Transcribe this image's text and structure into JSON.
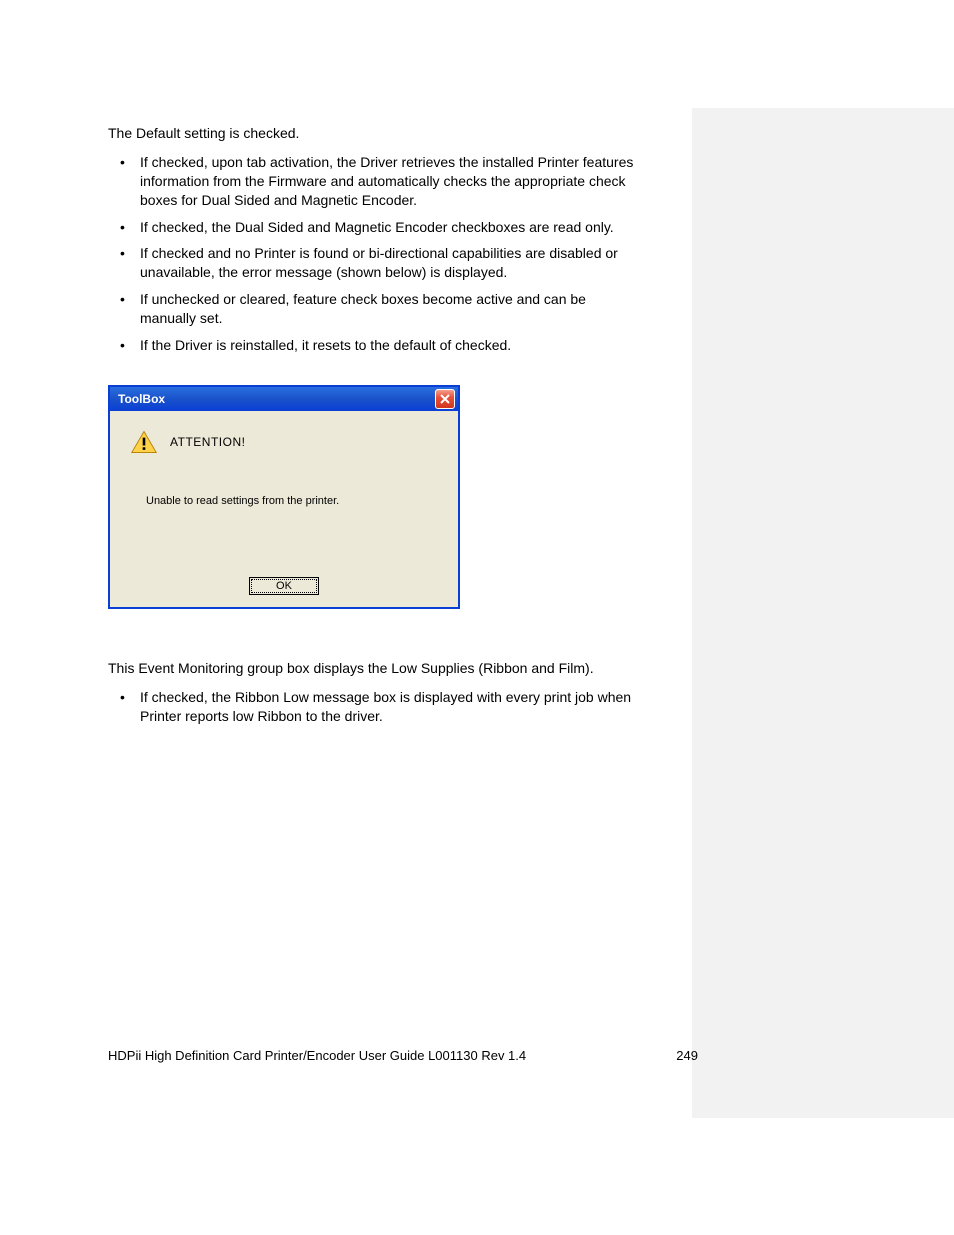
{
  "intro": "The Default setting is checked.",
  "bullets1": [
    "If checked, upon                               tab activation, the Driver retrieves the installed Printer features information from the Firmware and automatically checks the appropriate check boxes for Dual Sided and Magnetic Encoder.",
    "If checked, the Dual Sided and Magnetic Encoder checkboxes are read only.",
    "If checked and no Printer is found or bi-directional capabilities are disabled or unavailable, the error message (shown below) is displayed.",
    "If unchecked or cleared, feature check boxes become active and can be manually set.",
    "If the Driver is reinstalled, it resets to the default of checked."
  ],
  "dialog": {
    "title": "ToolBox",
    "attention": "ATTENTION!",
    "message": "Unable to read settings from the printer.",
    "ok_label": "OK"
  },
  "section2_intro": "This Event Monitoring group box displays the Low Supplies (Ribbon and Film).",
  "bullets2": [
    "                                                       If checked, the Ribbon Low message box is displayed with every print job when Printer reports low Ribbon to the driver."
  ],
  "footer_left": "HDPii High Definition Card Printer/Encoder User Guide    L001130 Rev 1.4",
  "footer_right": "249"
}
